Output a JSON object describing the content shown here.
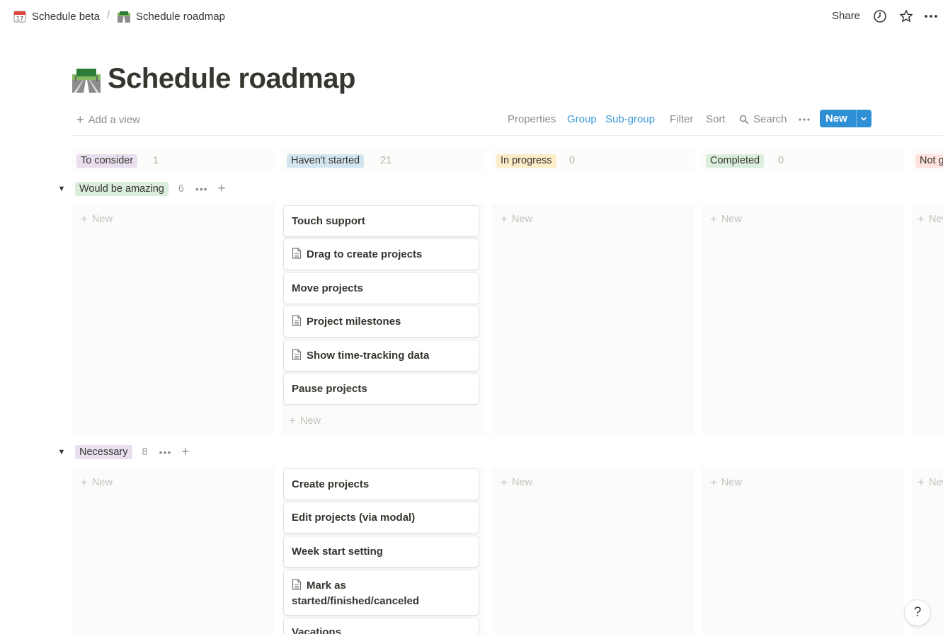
{
  "breadcrumb": {
    "parent": {
      "label": "Schedule beta",
      "icon": "calendar-icon"
    },
    "separator": "/",
    "current": {
      "label": "Schedule roadmap",
      "icon": "road-icon"
    }
  },
  "topbar": {
    "share_label": "Share",
    "icons": [
      "clock-icon",
      "star-icon",
      "more-icon"
    ]
  },
  "page": {
    "title": "Schedule roadmap",
    "title_icon": "road-icon"
  },
  "toolbar": {
    "add_view_label": "Add a view",
    "properties_label": "Properties",
    "group_label": "Group",
    "subgroup_label": "Sub-group",
    "filter_label": "Filter",
    "sort_label": "Sort",
    "search_label": "Search",
    "new_label": "New",
    "accent_color": "#2e8fd4"
  },
  "columns": [
    {
      "label": "To consider",
      "count": "1",
      "color": "#e8deee"
    },
    {
      "label": "Haven't started",
      "count": "21",
      "color": "#d3e5ef"
    },
    {
      "label": "In progress",
      "count": "0",
      "color": "#fdecc8"
    },
    {
      "label": "Completed",
      "count": "0",
      "color": "#dbeddb"
    },
    {
      "label": "Not g",
      "count": "",
      "color": "#ffe2dd"
    }
  ],
  "new_label": "New",
  "groups": [
    {
      "label": "Would be amazing",
      "count": "6",
      "color": "#dbeddb",
      "cards": [
        {
          "title": "Touch support",
          "has_doc": false
        },
        {
          "title": "Drag to create projects",
          "has_doc": true
        },
        {
          "title": "Move projects",
          "has_doc": false
        },
        {
          "title": "Project milestones",
          "has_doc": true
        },
        {
          "title": "Show time-tracking data",
          "has_doc": true
        },
        {
          "title": "Pause projects",
          "has_doc": false
        }
      ],
      "new_label": "New"
    },
    {
      "label": "Necessary",
      "count": "8",
      "color": "#e8deee",
      "cards": [
        {
          "title": "Create projects",
          "has_doc": false
        },
        {
          "title": "Edit projects (via modal)",
          "has_doc": false
        },
        {
          "title": "Week start setting",
          "has_doc": false
        },
        {
          "title": "Mark as started/finished/canceled",
          "has_doc": true
        },
        {
          "title": "Vacations",
          "has_doc": false
        }
      ]
    }
  ],
  "help_label": "?"
}
